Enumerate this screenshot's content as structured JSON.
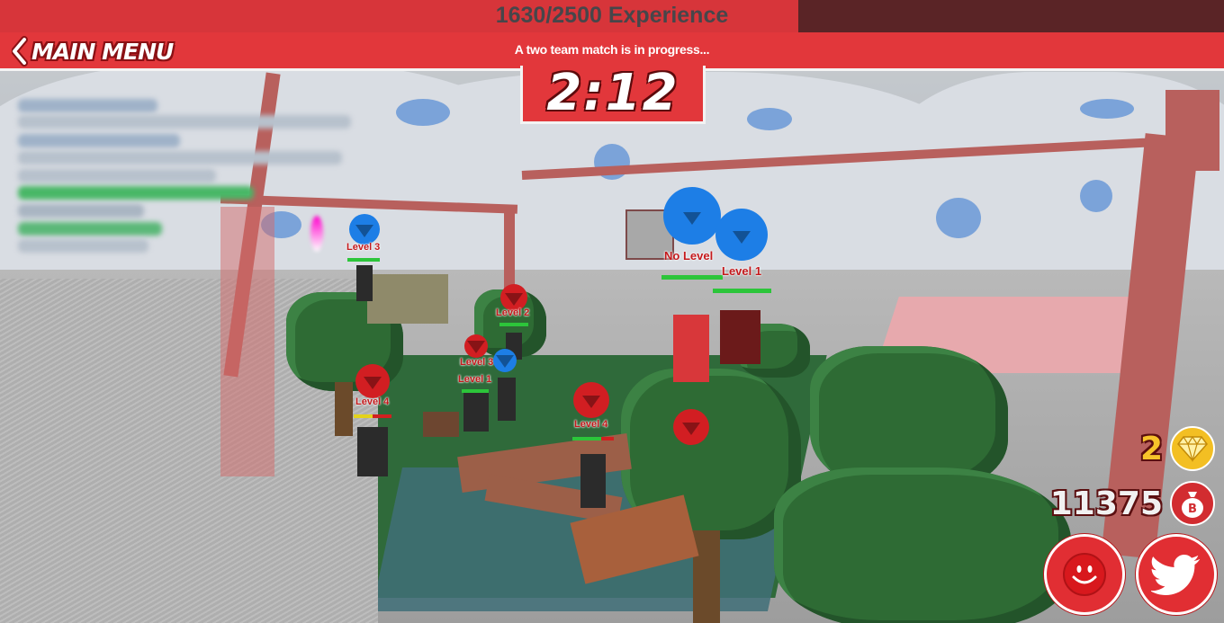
{
  "experience": {
    "text": "1630/2500 Experience",
    "current": 1630,
    "max": 2500
  },
  "menu": {
    "back_label": "MAIN MENU"
  },
  "match": {
    "status": "A two team match is in progress...",
    "timer": "2:12"
  },
  "currency": {
    "gems": "2",
    "cash": "11375"
  },
  "players": [
    {
      "label": "Level 3",
      "team": "blue"
    },
    {
      "label": "Level 2",
      "team": "red"
    },
    {
      "label": "Level 3",
      "team": "red"
    },
    {
      "label": "Level 1",
      "team": "red"
    },
    {
      "label": "Level 4",
      "team": "red"
    },
    {
      "label": "Level 4",
      "team": "red"
    },
    {
      "label": "No Level",
      "team": "blue"
    },
    {
      "label": "Level 1",
      "team": "blue"
    }
  ],
  "colors": {
    "accent": "#e2373b",
    "xp_bar_bg": "#5a2426",
    "gem": "#f3bf23",
    "blue_team": "#1d7ee6",
    "red_team": "#d21e22"
  },
  "icons": [
    "chevron-left-icon",
    "gem-icon",
    "money-bag-icon",
    "roblox-smiley-icon",
    "twitter-bird-icon"
  ]
}
